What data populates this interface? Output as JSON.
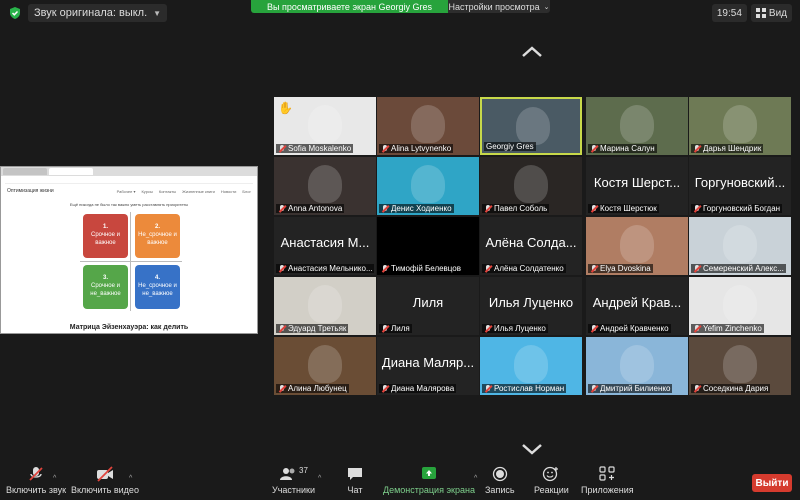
{
  "topbar": {
    "audio_original": "Звук оригинала: выкл.",
    "share_banner": "Вы просматриваете экран Georgiy Gres",
    "view_settings": "Настройки просмотра",
    "clock": "19:54",
    "view_label": "Вид"
  },
  "shared_screen": {
    "site_title": "Оптимизация жизни",
    "nav": [
      "Рабочее ▾",
      "Курсы",
      "Контакты",
      "Жизненные книги",
      "Новости",
      "Блог"
    ],
    "caption": "Ещё никогда не было так важно уметь расставлять приоритеты",
    "quadrants": [
      {
        "num": "1.",
        "text": "Срочное и важное"
      },
      {
        "num": "2.",
        "text": "Не_срочное и важное"
      },
      {
        "num": "3.",
        "text": "Срочное и не_важное"
      },
      {
        "num": "4.",
        "text": "Не_срочное и не_важное"
      }
    ],
    "footer": "Матрица Эйзенхауэра: как делить"
  },
  "participants": [
    {
      "name": "Sofia Moskalenko",
      "hand": "✋",
      "kind": "video",
      "bg": "#e8e8e8"
    },
    {
      "name": "Alina Lytvynenko",
      "kind": "video",
      "bg": "#6b4a3a"
    },
    {
      "name": "Georgiy Gres",
      "kind": "video",
      "bg": "#4a5a64",
      "speaking": true
    },
    {
      "name": "Марина Салун",
      "kind": "video",
      "bg": "#5d6c4d"
    },
    {
      "name": "Дарья Шендрик",
      "kind": "video",
      "bg": "#6e7a55"
    },
    {
      "name": "Anna Antonova",
      "kind": "video",
      "bg": "#3a3230"
    },
    {
      "name": "Денис Ходиенко",
      "kind": "video",
      "bg": "#2fa5c6"
    },
    {
      "name": "Павел Соболь",
      "kind": "video",
      "bg": "#2a2624"
    },
    {
      "name": "Костя Шерстюк",
      "big": "Костя Шерст...",
      "kind": "name"
    },
    {
      "name": "Горгуновский Богдан",
      "big": "Горгуновский...",
      "kind": "name"
    },
    {
      "name": "Анастасия Мельнико...",
      "big": "Анастасия М...",
      "kind": "name"
    },
    {
      "name": "Тимофій Белевцов",
      "kind": "black"
    },
    {
      "name": "Алёна Солдатенко",
      "big": "Алёна Солда...",
      "kind": "name"
    },
    {
      "name": "Elya Dvoskina",
      "kind": "video",
      "bg": "#b07d63"
    },
    {
      "name": "Семеренский Алекс...",
      "kind": "video",
      "bg": "#c9d2d8"
    },
    {
      "name": "Эдуард Третьяк",
      "kind": "video",
      "bg": "#d2cfc7"
    },
    {
      "name": "Лиля",
      "big": "Лиля",
      "kind": "name"
    },
    {
      "name": "Илья Луценко",
      "big": "Илья Луценко",
      "kind": "name"
    },
    {
      "name": "Андрей Кравченко",
      "big": "Андрей Крав...",
      "kind": "name"
    },
    {
      "name": "Yefim Zinchenko",
      "kind": "video",
      "bg": "#e6e6e6"
    },
    {
      "name": "Алина Любунец",
      "kind": "video",
      "bg": "#6a4d35"
    },
    {
      "name": "Диана Малярова",
      "big": "Диана Маляр...",
      "kind": "name"
    },
    {
      "name": "Ростислав Норман",
      "kind": "video",
      "bg": "#4fb6e5"
    },
    {
      "name": "Дмитрий Билиенко",
      "kind": "video",
      "bg": "#8ab6d9"
    },
    {
      "name": "Соседкина Дария",
      "kind": "video",
      "bg": "#5b4a3d"
    }
  ],
  "toolbar": {
    "mute": "Включить звук",
    "video": "Включить видео",
    "participants": "Участники",
    "participants_count": "37",
    "chat": "Чат",
    "share": "Демонстрация экрана",
    "record": "Запись",
    "reactions": "Реакции",
    "apps": "Приложения",
    "leave": "Выйти"
  },
  "colors": {
    "share_green": "#27a33c",
    "speaker_border": "#c8d94a",
    "leave_red": "#d53b2e",
    "muted_red": "#e0443d"
  }
}
